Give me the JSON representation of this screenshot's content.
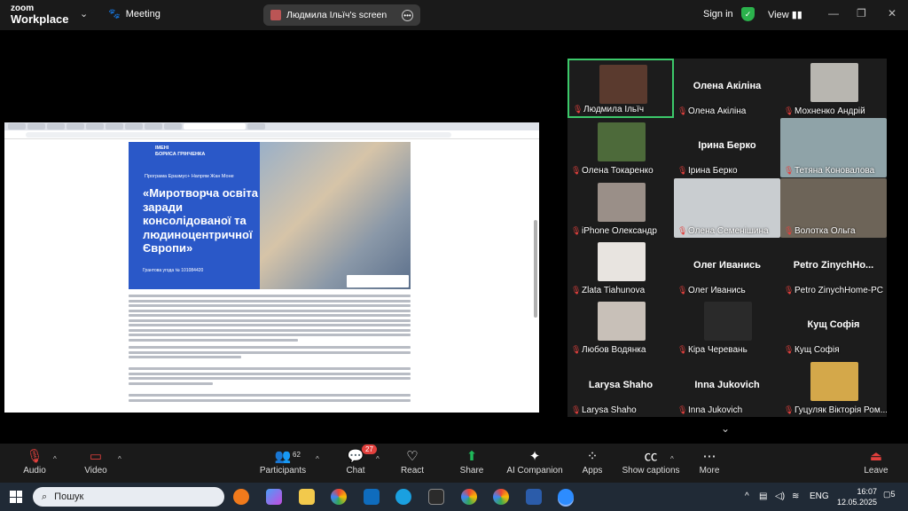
{
  "app": {
    "logo_line1": "zoom",
    "logo_line2": "Workplace",
    "meeting_label": "Meeting",
    "share_label": "Людмила Ільїч's screen",
    "sign_in": "Sign in",
    "view": "View"
  },
  "poster": {
    "header": "ІМЕНІ\nБОРИСА ГРІНЧЕНКА",
    "program": "Програма Еразмус+ Напрям Жан Моне",
    "title": "«Миротворча освіта заради консолідованої та людиноцентричної Європи»",
    "grant": "Грантова угода № 101084420"
  },
  "gallery": [
    {
      "name": "Людмила Ільїч",
      "big": "",
      "photo": "#5a3a2e",
      "active": true
    },
    {
      "name": "Олена Акіліна",
      "big": "Олена Акіліна",
      "photo": ""
    },
    {
      "name": "Мохненко Андрій",
      "big": "",
      "photo": "#b8b6b0"
    },
    {
      "name": "Олена Токаренко",
      "big": "",
      "photo": "#4d6a3a"
    },
    {
      "name": "Ірина Берко",
      "big": "Ірина Берко",
      "photo": ""
    },
    {
      "name": "Тетяна Коновалова",
      "big": "",
      "photo": "#8fa3a8",
      "wide": true
    },
    {
      "name": "iPhone Олександр",
      "big": "",
      "photo": "#9a8f88"
    },
    {
      "name": "Олена Семенішина",
      "big": "",
      "photo": "#c9cdd0",
      "wide": true
    },
    {
      "name": "Волотка Ольга",
      "big": "",
      "photo": "#6d6458",
      "wide": true
    },
    {
      "name": "Zlata Tiahunova",
      "big": "",
      "photo": "#e8e4e0"
    },
    {
      "name": "Олег Иванись",
      "big": "Олег Иванись",
      "photo": ""
    },
    {
      "name": "Petro ZinychHome-PC",
      "big": "Petro  ZinychHo...",
      "photo": ""
    },
    {
      "name": "Любов Водянка",
      "big": "",
      "photo": "#c8c0b8"
    },
    {
      "name": "Кіра Черевань",
      "big": "",
      "photo": "#2a2a2a"
    },
    {
      "name": "Кущ Софія",
      "big": "Кущ Софія",
      "photo": ""
    },
    {
      "name": "Larysa Shaho",
      "big": "Larysa Shaho",
      "photo": ""
    },
    {
      "name": "Inna Jukovich",
      "big": "Inna Jukovich",
      "photo": ""
    },
    {
      "name": "Гуцуляк Вікторія Ром...",
      "big": "",
      "photo": "#d4a84a"
    }
  ],
  "toolbar": {
    "audio": "Audio",
    "video": "Video",
    "participants": "Participants",
    "participants_count": "62",
    "chat": "Chat",
    "chat_badge": "27",
    "react": "React",
    "share": "Share",
    "ai": "AI Companion",
    "apps": "Apps",
    "captions": "Show captions",
    "more": "More",
    "leave": "Leave"
  },
  "taskbar": {
    "search": "Пошук",
    "lang": "ENG",
    "time": "16:07",
    "date": "12.05.2025",
    "notif": "5"
  }
}
